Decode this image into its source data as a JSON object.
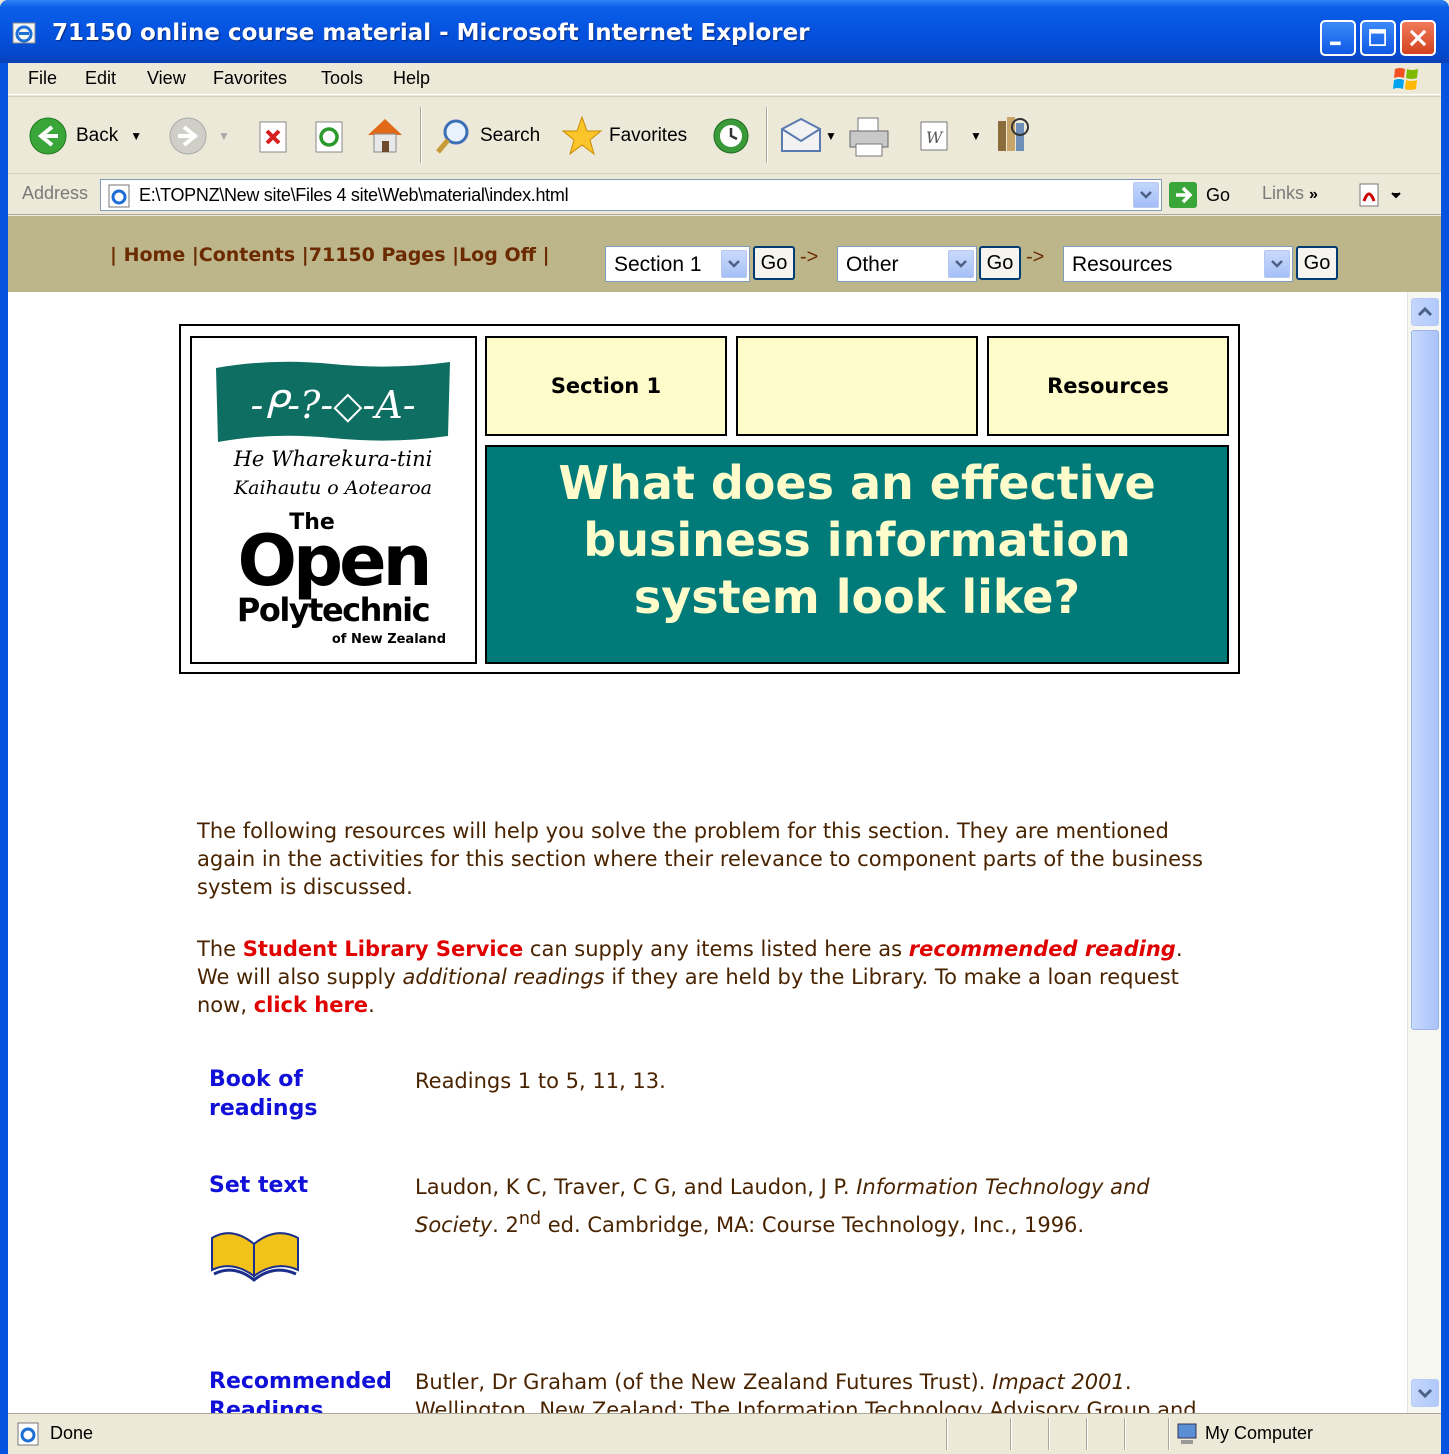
{
  "window": {
    "title": "71150 online course material - Microsoft Internet Explorer"
  },
  "menu": [
    "File",
    "Edit",
    "View",
    "Favorites",
    "Tools",
    "Help"
  ],
  "toolbar": {
    "back": "Back",
    "search": "Search",
    "favorites": "Favorites"
  },
  "address": {
    "label": "Address",
    "url": "E:\\TOPNZ\\New site\\Files 4 site\\Web\\material\\index.html",
    "go": "Go",
    "links": "Links"
  },
  "nav": {
    "links": [
      "Home",
      "Contents",
      "71150 Pages",
      "Log Off"
    ],
    "select1": "Section 1",
    "select2": "Other",
    "select3": "Resources",
    "go": "Go",
    "arrow": "->"
  },
  "header": {
    "tab1": "Section 1",
    "tab2": "",
    "tab3": "Resources",
    "title_line1": "What does an effective",
    "title_line2": "business information",
    "title_line3": "system look like?",
    "logo_maori1": "He Wharekura-tini",
    "logo_maori2": "Kaihautu o Aotearoa",
    "logo_the": "The",
    "logo_open": "Open",
    "logo_poly": "Polytechnic",
    "logo_nz": "of New Zealand",
    "logo_band": "-ᑭ-?-◇-A-"
  },
  "content": {
    "intro": "The following resources will help you solve the problem for this section. They are mentioned again in the activities for this section where their relevance to component parts of the business system is discussed.",
    "lib_pre": "The ",
    "lib_link": "Student Library Service",
    "lib_mid": " can supply any items listed here as ",
    "lib_rec": "recommended reading",
    "lib_mid2": ". We will also supply ",
    "lib_add": "additional readings",
    "lib_mid3": " if they are held by the Library. To make a loan request now, ",
    "lib_click": "click here",
    "lib_end": ".",
    "book_label1": "Book of",
    "book_label2": "readings",
    "book_desc": "Readings 1 to 5, 11, 13.",
    "set_label": "Set text",
    "set_desc_pre": "Laudon, K C, Traver, C G, and Laudon, J P. ",
    "set_desc_title": "Information Technology and Society",
    "set_desc_mid": ". 2",
    "set_desc_sup": "nd",
    "set_desc_post": " ed. Cambridge, MA: Course Technology, Inc., 1996.",
    "rec_label1": "Recommended",
    "rec_label2": "Readings",
    "rec_desc_pre": "Butler, Dr Graham (of the New Zealand Futures Trust). ",
    "rec_desc_title": "Impact 2001",
    "rec_desc_post": ". Wellington, New Zealand: The Information Technology Advisory Group and the Information Technology Association of New Zealand. 1996."
  },
  "status": {
    "left": "Done",
    "zone": "My Computer"
  },
  "colors": {
    "nav_band": "#bdb68a",
    "title_bg": "#007b7a",
    "tab_bg": "#fffccc",
    "link_red": "#e00000",
    "label_blue": "#1010d8"
  }
}
